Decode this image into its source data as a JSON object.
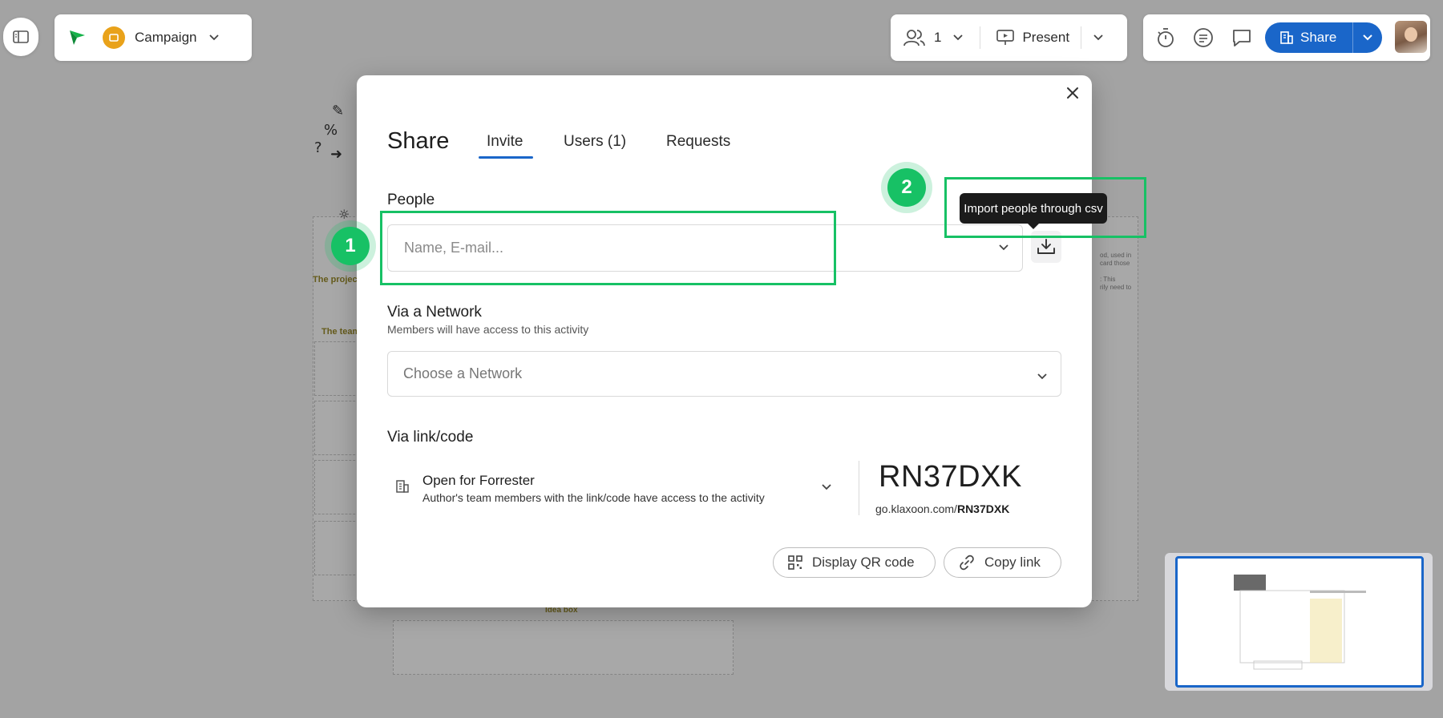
{
  "header": {
    "campaign_label": "Campaign",
    "participants_count": "1",
    "present_label": "Present",
    "share_label": "Share"
  },
  "board": {
    "project_label": "The project",
    "team_label": "The team",
    "idea_box_label": "Idea box",
    "side_text": "od, used in\ncard those\n\n: This\nrily need to"
  },
  "modal": {
    "title": "Share",
    "tabs": [
      {
        "label": "Invite"
      },
      {
        "label": "Users (1)"
      },
      {
        "label": "Requests"
      }
    ],
    "people_label": "People",
    "people_placeholder": "Name, E-mail...",
    "tooltip": "Import people through csv",
    "network_label": "Via a Network",
    "network_sub": "Members will have access to this activity",
    "network_placeholder": "Choose a Network",
    "link_label": "Via link/code",
    "access_title": "Open for Forrester",
    "access_desc": "Author's team members with the link/code have access to the activity",
    "code": "RN37DXK",
    "code_url_prefix": "go.klaxoon.com/",
    "code_url_code": "RN37DXK",
    "qr_label": "Display QR code",
    "copy_label": "Copy link"
  },
  "annotations": {
    "marker1": "1",
    "marker2": "2",
    "color": "#17c165"
  },
  "colors": {
    "accent": "#1a66c9",
    "annotation": "#17c165"
  }
}
